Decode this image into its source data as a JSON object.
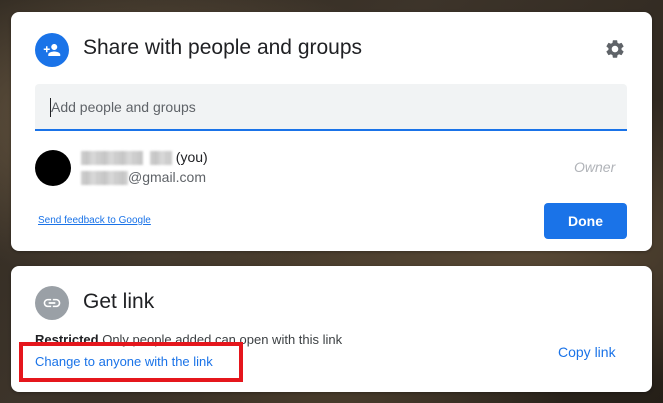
{
  "share_dialog": {
    "title": "Share with people and groups",
    "icon": "person-add-icon",
    "settings_icon": "gear-icon",
    "add_field": {
      "value": "",
      "placeholder": "Add people and groups"
    },
    "user": {
      "name_suffix": "(you)",
      "email_suffix": "@gmail.com",
      "role": "Owner"
    },
    "feedback_link": "Send feedback to Google",
    "done_label": "Done"
  },
  "link_dialog": {
    "title": "Get link",
    "icon": "link-icon",
    "restriction_label": "Restricted",
    "restriction_desc": "Only people added can open with this link",
    "change_link": "Change to anyone with the link",
    "copy_link": "Copy link"
  },
  "annotation": {
    "highlight_color": "#e5161c",
    "target": "change-link"
  },
  "colors": {
    "accent": "#1a73e8",
    "card_bg": "#ffffff",
    "link_icon_bg": "#9aa0a6"
  }
}
